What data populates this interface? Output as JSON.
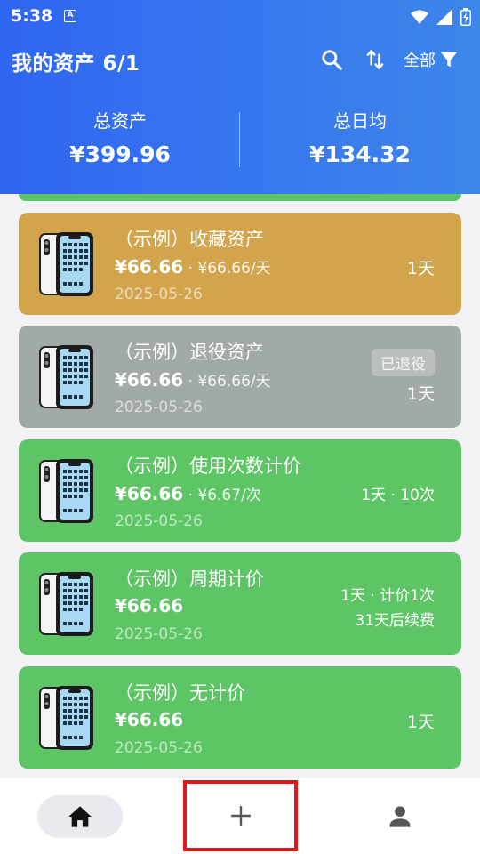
{
  "status_bar": {
    "time": "5:38",
    "app_icon_letter": "A"
  },
  "header": {
    "title": "我的资产 6/1",
    "filter_label": "全部",
    "total_assets_label": "总资产",
    "total_assets_value": "¥399.96",
    "daily_avg_label": "总日均",
    "daily_avg_value": "¥134.32"
  },
  "assets": [
    {
      "name": "（示例）收藏资产",
      "price": "¥66.66",
      "unit": " · ¥66.66/天",
      "date": "2025-05-26",
      "right_line1": "1天",
      "right_line2": "",
      "badge": "",
      "color": "#d2a54d"
    },
    {
      "name": "（示例）退役资产",
      "price": "¥66.66",
      "unit": " · ¥66.66/天",
      "date": "2025-05-26",
      "right_line1": "1天",
      "right_line2": "",
      "badge": "已退役",
      "color": "#a2aaa7"
    },
    {
      "name": "（示例）使用次数计价",
      "price": "¥66.66",
      "unit": " · ¥6.67/次",
      "date": "2025-05-26",
      "right_line1": "1天 · 10次",
      "right_line2": "",
      "badge": "",
      "color": "#5ec566"
    },
    {
      "name": "（示例）周期计价",
      "price": "¥66.66",
      "unit": "",
      "date": "2025-05-26",
      "right_line1": "1天 · 计价1次",
      "right_line2": "31天后续费",
      "badge": "",
      "color": "#5ec566"
    },
    {
      "name": "（示例）无计价",
      "price": "¥66.66",
      "unit": "",
      "date": "2025-05-26",
      "right_line1": "1天",
      "right_line2": "",
      "badge": "",
      "color": "#5ec566"
    }
  ],
  "colors": {
    "header_start": "#2f66f2",
    "header_end": "#3e86ea",
    "highlight_border": "#e01818"
  },
  "icons": {
    "search": "search-icon",
    "sort": "sort-arrows-icon",
    "filter": "funnel-icon",
    "home": "home-icon",
    "add": "plus-icon",
    "profile": "person-icon"
  }
}
